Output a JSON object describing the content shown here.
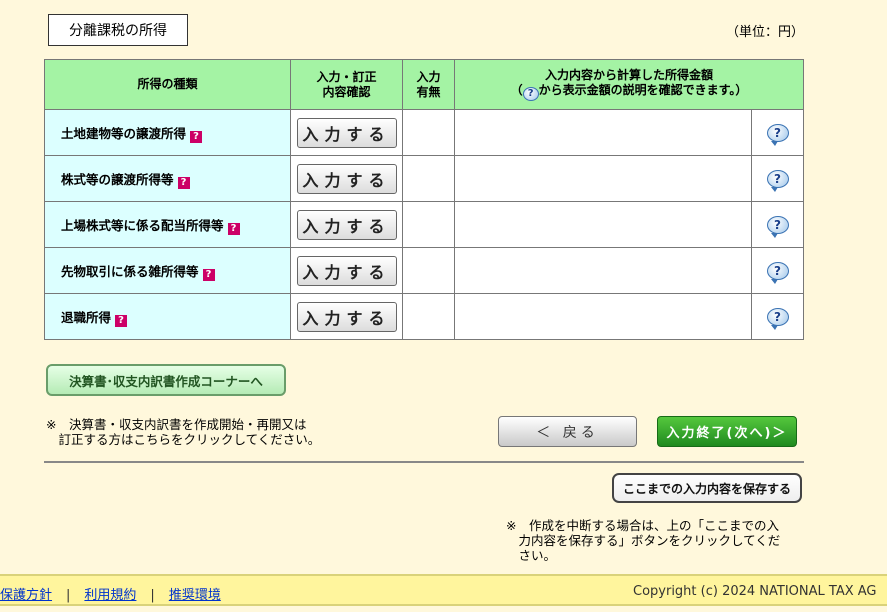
{
  "section_title": "分離課税の所得",
  "unit_label": "（単位：円）",
  "table": {
    "headers": {
      "category": "所得の種類",
      "input_confirm_line1": "入力・訂正",
      "input_confirm_line2": "内容確認",
      "presence_line1": "入力",
      "presence_line2": "有無",
      "amount_line1": "入力内容から計算した所得金額",
      "amount_line2_prefix": "（",
      "amount_line2_suffix": "から表示金額の説明を確認できます。）"
    },
    "rows": [
      {
        "name": "土地建物等の譲渡所得",
        "button": "入力する",
        "presence": "",
        "amount": ""
      },
      {
        "name": "株式等の譲渡所得等",
        "button": "入力する",
        "presence": "",
        "amount": ""
      },
      {
        "name": "上場株式等に係る配当所得等",
        "button": "入力する",
        "presence": "",
        "amount": ""
      },
      {
        "name": "先物取引に係る雑所得等",
        "button": "入力する",
        "presence": "",
        "amount": ""
      },
      {
        "name": "退職所得",
        "button": "入力する",
        "presence": "",
        "amount": ""
      }
    ]
  },
  "help_mark": "?",
  "corner_button": "決算書･収支内訳書作成コーナーへ",
  "note1_line1": "※　決算書・収支内訳書を作成開始・再開又は",
  "note1_line2": "　訂正する方はこちらをクリックしてください。",
  "back_button": "＜ 戻る",
  "next_button": "入力終了(次へ)＞",
  "save_button": "ここまでの入力内容を保存する",
  "note2_line1": "※　作成を中断する場合は、上の「ここまでの入",
  "note2_line2": "　力内容を保存する」ボタンをクリックしてくだ",
  "note2_line3": "　さい。",
  "footer": {
    "links": [
      "保護方針",
      "利用規約",
      "推奨環境"
    ],
    "separator": "|",
    "copyright": "Copyright (c) 2024 NATIONAL TAX AG"
  }
}
